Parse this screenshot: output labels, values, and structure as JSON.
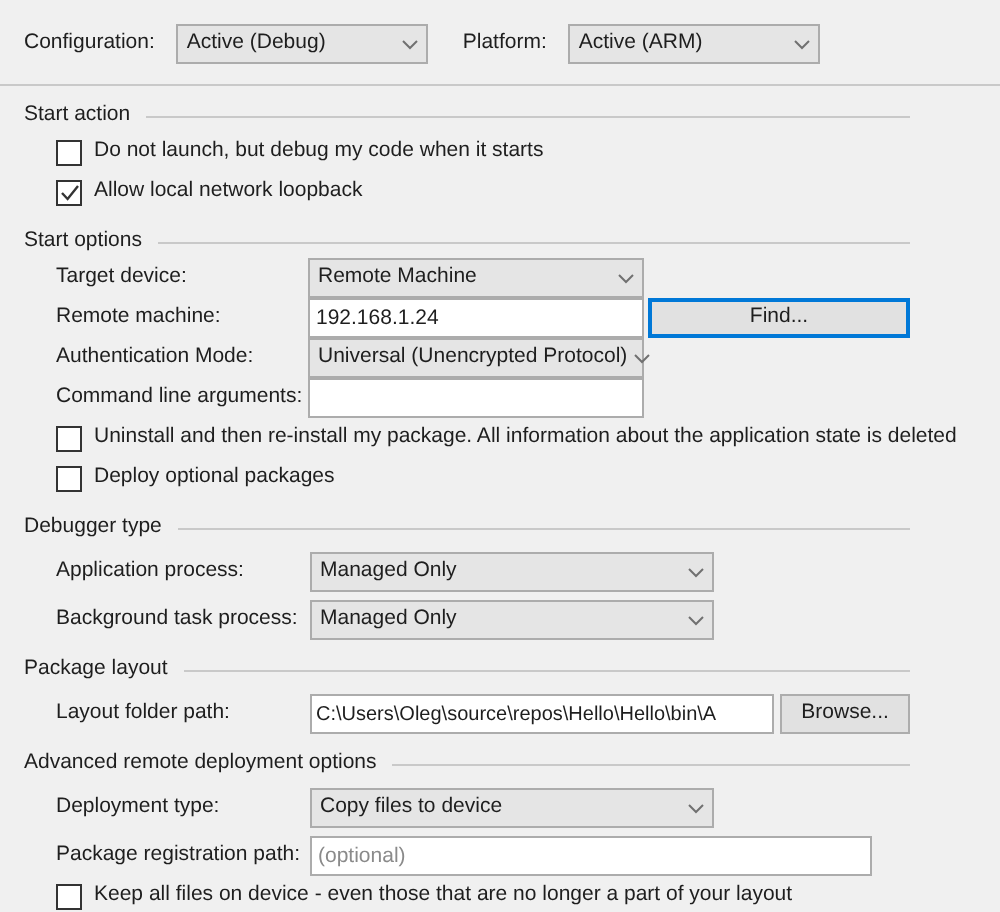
{
  "configuration": {
    "label": "Configuration:",
    "value": "Active (Debug)"
  },
  "platform": {
    "label": "Platform:",
    "value": "Active (ARM)"
  },
  "sections": [
    {
      "title": "Start action",
      "rows": [
        {
          "kind": "checkbox",
          "label": "Do not launch, but debug my code when it starts",
          "checked": false
        },
        {
          "kind": "checkbox",
          "label": "Allow local network loopback",
          "checked": true
        }
      ]
    },
    {
      "title": "Start options",
      "rows": [
        {
          "kind": "select",
          "label": "Target device:",
          "value": "Remote Machine"
        },
        {
          "kind": "text",
          "label": "Remote machine:",
          "value": "192.168.1.24",
          "button": {
            "label": "Find...",
            "focused": true
          }
        },
        {
          "kind": "select",
          "label": "Authentication Mode:",
          "value": "Universal (Unencrypted Protocol)"
        },
        {
          "kind": "text",
          "label": "Command line arguments:"
        },
        {
          "kind": "checkbox",
          "label": "Uninstall and then re-install my package. All information about the application state is deleted",
          "checked": false
        },
        {
          "kind": "checkbox",
          "label": "Deploy optional packages",
          "checked": false
        }
      ]
    },
    {
      "title": "Debugger type",
      "rows": [
        {
          "kind": "select",
          "label": "Application process:",
          "value": "Managed Only"
        },
        {
          "kind": "select",
          "label": "Background task process:",
          "value": "Managed Only"
        }
      ]
    },
    {
      "title": "Package layout",
      "rows": [
        {
          "kind": "text",
          "label": "Layout folder path:",
          "value": "C:\\Users\\Oleg\\source\\repos\\Hello\\Hello\\bin\\A",
          "button": {
            "label": "Browse...",
            "focused": false
          }
        }
      ]
    },
    {
      "title": "Advanced remote deployment options",
      "rows": [
        {
          "kind": "select",
          "label": "Deployment type:",
          "value": "Copy files to device"
        },
        {
          "kind": "text",
          "label": "Package registration path:",
          "placeholder": "(optional)"
        },
        {
          "kind": "checkbox",
          "label": "Keep all files on device - even those that are no longer a part of your layout",
          "checked": false
        }
      ]
    }
  ]
}
